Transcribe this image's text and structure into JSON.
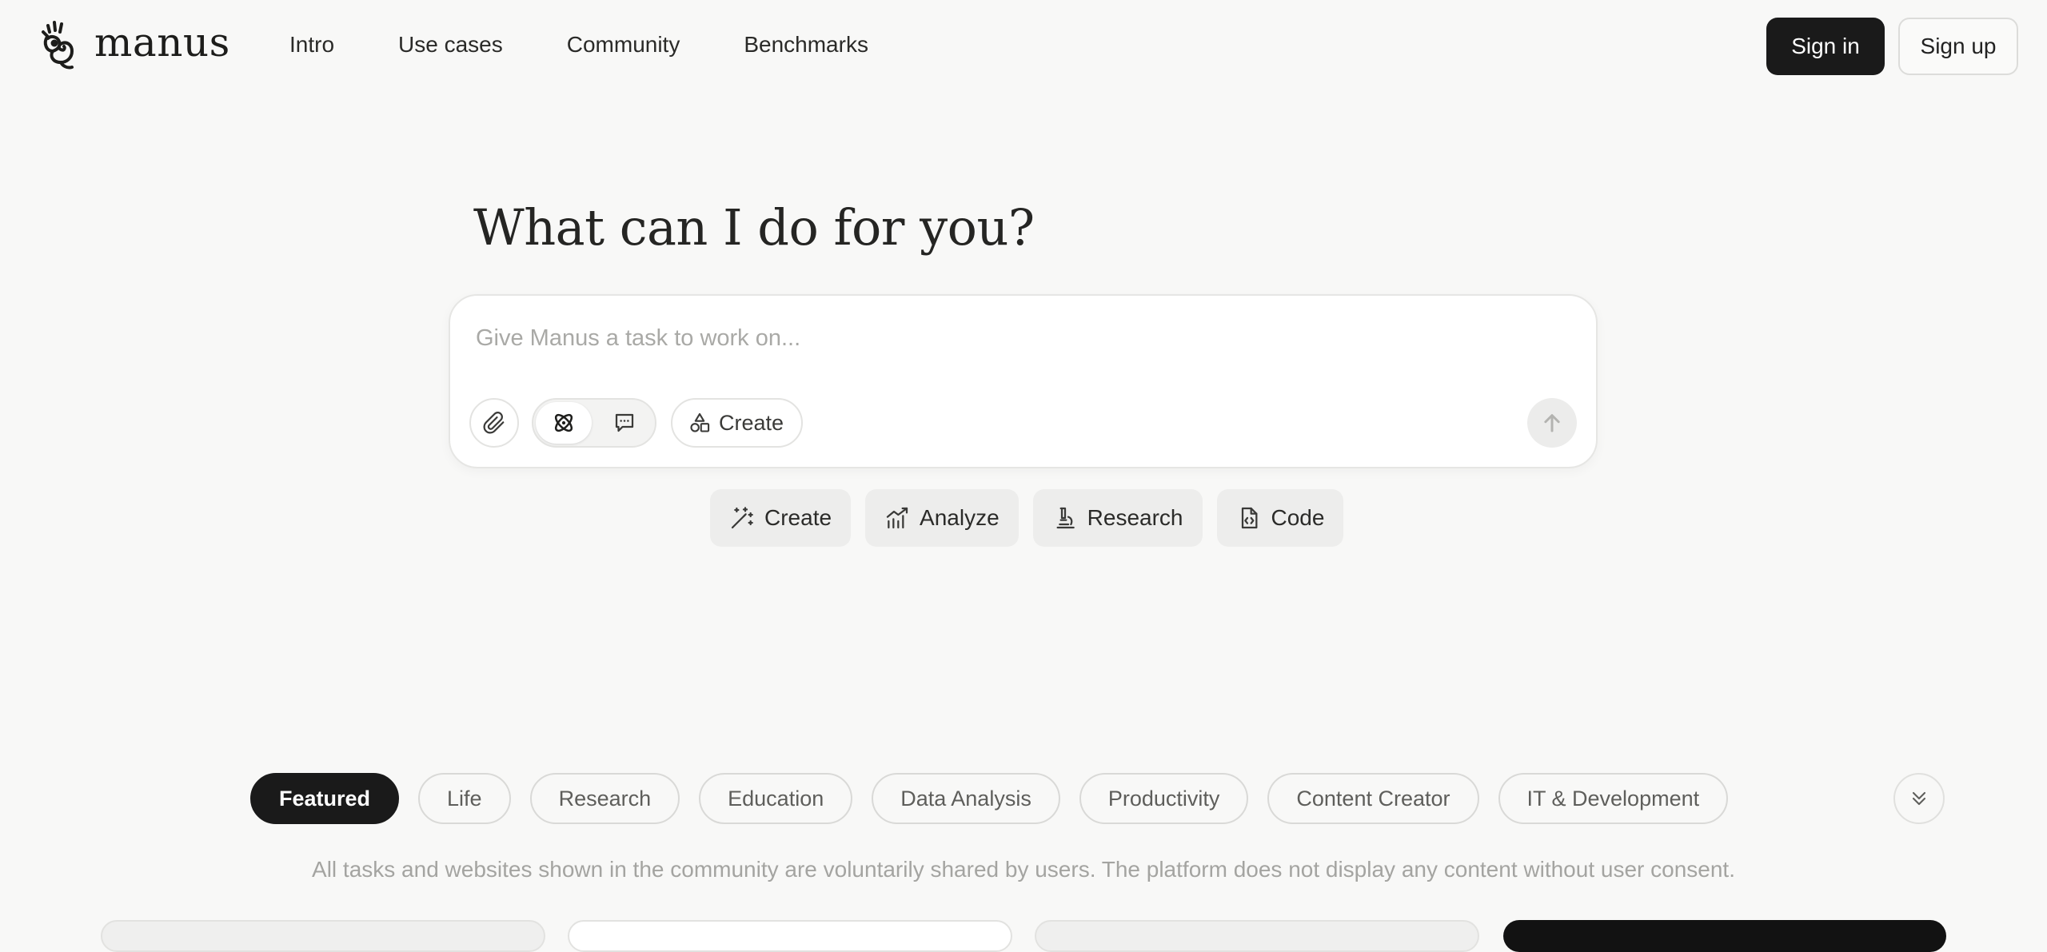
{
  "brand": {
    "name": "manus",
    "logo_icon": "manus-hand-logo-icon"
  },
  "nav": {
    "items": [
      {
        "label": "Intro"
      },
      {
        "label": "Use cases"
      },
      {
        "label": "Community"
      },
      {
        "label": "Benchmarks"
      }
    ]
  },
  "auth": {
    "sign_in": "Sign in",
    "sign_up": "Sign up"
  },
  "hero": {
    "title": "What can I do for you?"
  },
  "composer": {
    "placeholder": "Give Manus a task to work on...",
    "value": "",
    "attach_icon": "paperclip-icon",
    "modes": [
      {
        "icon": "agent-icon",
        "active": true
      },
      {
        "icon": "chat-icon",
        "active": false
      }
    ],
    "create_label": "Create",
    "create_icon": "shapes-icon",
    "send_icon": "arrow-up-icon"
  },
  "quick_actions": [
    {
      "label": "Create",
      "icon": "magic-wand-icon"
    },
    {
      "label": "Analyze",
      "icon": "chart-icon"
    },
    {
      "label": "Research",
      "icon": "microscope-icon"
    },
    {
      "label": "Code",
      "icon": "code-file-icon"
    }
  ],
  "categories": [
    {
      "label": "Featured",
      "active": true
    },
    {
      "label": "Life",
      "active": false
    },
    {
      "label": "Research",
      "active": false
    },
    {
      "label": "Education",
      "active": false
    },
    {
      "label": "Data Analysis",
      "active": false
    },
    {
      "label": "Productivity",
      "active": false
    },
    {
      "label": "Content Creator",
      "active": false
    },
    {
      "label": "IT & Development",
      "active": false
    }
  ],
  "expand_icon": "chevrons-down-icon",
  "disclaimer": "All tasks and websites shown in the community are voluntarily shared by users. The platform does not display any content without user consent.",
  "colors": {
    "background": "#f8f8f7",
    "primary_button": "#1a1a1a",
    "chip_background": "#ededec",
    "muted_text": "#a4a4a1"
  }
}
